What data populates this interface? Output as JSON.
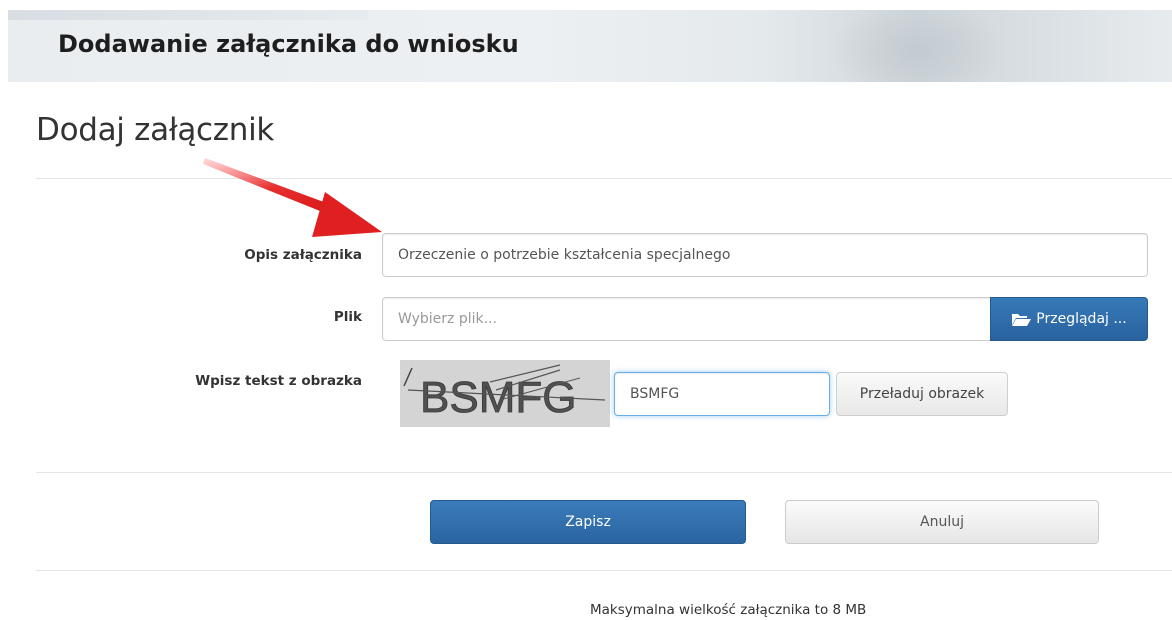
{
  "header": {
    "title": "Dodawanie załącznika do wniosku"
  },
  "page": {
    "heading": "Dodaj załącznik"
  },
  "form": {
    "description": {
      "label": "Opis załącznika",
      "value": "Orzeczenie o potrzebie kształcenia specjalnego"
    },
    "file": {
      "label": "Plik",
      "placeholder": "Wybierz plik...",
      "browse_label": "Przeglądaj ..."
    },
    "captcha": {
      "label": "Wpisz tekst z obrazka",
      "image_text": "BSMFG",
      "value": "BSMFG",
      "reload_label": "Przeładuj obrazek"
    }
  },
  "actions": {
    "save_label": "Zapisz",
    "cancel_label": "Anuluj"
  },
  "footer": {
    "note": "Maksymalna wielkość załącznika to 8 MB"
  },
  "colors": {
    "primary_button": "#2e6da4",
    "annotation_arrow": "#e02020"
  },
  "icons": {
    "browse": "folder-open-icon",
    "annotation": "red-arrow-annotation"
  }
}
